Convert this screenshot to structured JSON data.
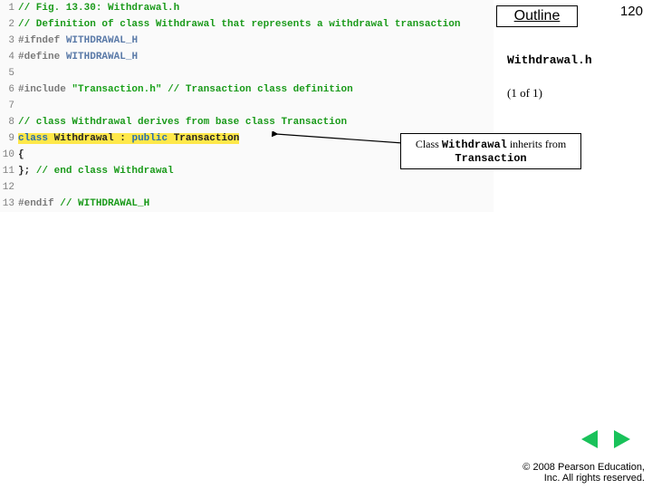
{
  "outline": {
    "title": "Outline"
  },
  "page_number": "120",
  "file_label": "Withdrawal.h",
  "page_of": "(1 of 1)",
  "callout": {
    "prefix": "Class ",
    "class1": "Withdrawal",
    "mid": " inherits from ",
    "class2": "Transaction"
  },
  "nav": {
    "prev_icon": "◄",
    "next_icon": "►"
  },
  "copyright": {
    "line1": "© 2008 Pearson Education,",
    "line2": "Inc.  All rights reserved."
  },
  "code": {
    "lines": [
      {
        "n": "1",
        "html": "<span class='cmt'>// Fig. 13.30: Withdrawal.h</span>"
      },
      {
        "n": "2",
        "html": "<span class='cmt'>// Definition of class Withdrawal that represents a withdrawal transaction</span>"
      },
      {
        "n": "3",
        "html": "<span class='pp'>#ifndef</span> <span class='ppid'>WITHDRAWAL_H</span>"
      },
      {
        "n": "4",
        "html": "<span class='pp'>#define</span> <span class='ppid'>WITHDRAWAL_H</span>"
      },
      {
        "n": "5",
        "html": ""
      },
      {
        "n": "6",
        "html": "<span class='pp'>#include</span> <span class='str'>\"Transaction.h\"</span> <span class='cmt'>// Transaction class definition</span>"
      },
      {
        "n": "7",
        "html": ""
      },
      {
        "n": "8",
        "html": "<span class='cmt'>// class Withdrawal derives from base class Transaction</span>"
      },
      {
        "n": "9",
        "html": "<span class='hl'><span class='kw'>class</span> <span class='id'>Withdrawal</span> <span class='id'>:</span> <span class='kw'>public</span> <span class='id'>Transaction</span></span>"
      },
      {
        "n": "10",
        "html": "<span class='id'>{</span>"
      },
      {
        "n": "11",
        "html": "<span class='id'>};</span> <span class='cmt'>// end class Withdrawal</span>"
      },
      {
        "n": "12",
        "html": ""
      },
      {
        "n": "13",
        "html": "<span class='pp'>#endif</span> <span class='cmt'>// WITHDRAWAL_H</span>"
      }
    ]
  }
}
